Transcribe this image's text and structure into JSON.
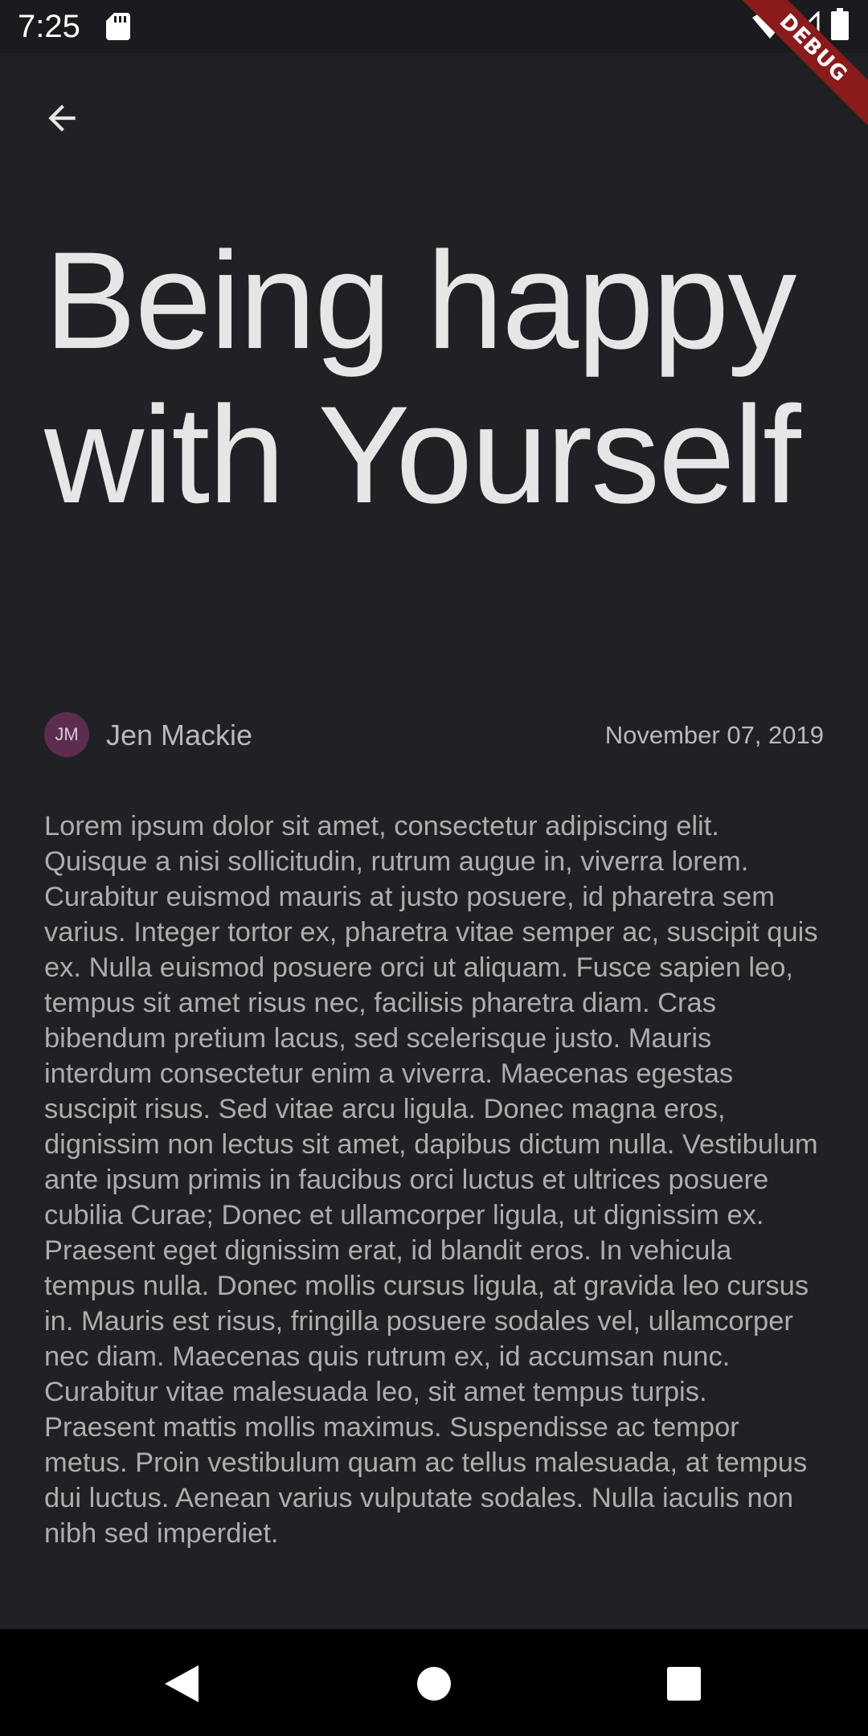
{
  "status_bar": {
    "time": "7:25",
    "icons": [
      "sd-card-icon",
      "wifi-icon",
      "signal-icon",
      "battery-icon"
    ]
  },
  "debug_banner": {
    "label": "DEBUG",
    "color": "#8b1a1a"
  },
  "app_bar": {
    "back_icon": "arrow-left-icon"
  },
  "article": {
    "title": "Being happy with Yourself",
    "author": {
      "initials": "JM",
      "name": "Jen Mackie",
      "avatar_color": "#5c2d4e"
    },
    "date": "November 07, 2019",
    "body": "Lorem ipsum dolor sit amet, consectetur adipiscing elit. Quisque a nisi sollicitudin, rutrum augue in, viverra lorem. Curabitur euismod mauris at justo posuere, id pharetra sem varius. Integer tortor ex, pharetra vitae semper ac, suscipit quis ex. Nulla euismod posuere orci ut aliquam. Fusce sapien leo, tempus sit amet risus nec, facilisis pharetra diam. Cras bibendum pretium lacus, sed scelerisque justo. Mauris interdum consectetur enim a viverra. Maecenas egestas suscipit risus. Sed vitae arcu ligula. Donec magna eros, dignissim non lectus sit amet, dapibus dictum nulla. Vestibulum ante ipsum primis in faucibus orci luctus et ultrices posuere cubilia Curae; Donec et ullamcorper ligula, ut dignissim ex. Praesent eget dignissim erat, id blandit eros. In vehicula tempus nulla. Donec mollis cursus ligula, at gravida leo cursus in. Mauris est risus, fringilla posuere sodales vel, ullamcorper nec diam. Maecenas quis rutrum ex, id accumsan nunc. Curabitur vitae malesuada leo, sit amet tempus turpis. Praesent mattis mollis maximus. Suspendisse ac tempor metus. Proin vestibulum quam ac tellus malesuada, at tempus dui luctus. Aenean varius vulputate sodales. Nulla iaculis non nibh sed imperdiet."
  },
  "nav_bar": {
    "buttons": [
      "nav-back-icon",
      "nav-home-icon",
      "nav-recents-icon"
    ]
  },
  "theme": {
    "background": "#202124",
    "title_color": "#e6e6e6",
    "text_color": "#adadaf"
  }
}
